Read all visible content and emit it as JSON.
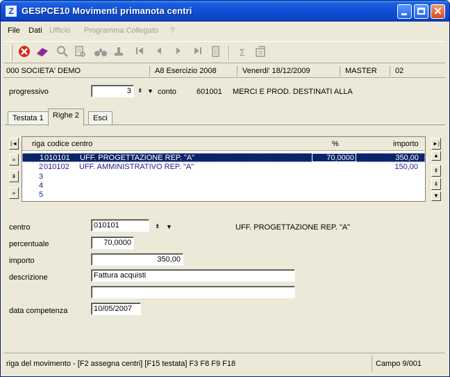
{
  "window": {
    "title": "GESPCE10  Movimenti primanota centri",
    "icon_glyph": "Z"
  },
  "menu": {
    "items": [
      {
        "label": "File",
        "enabled": true
      },
      {
        "label": "Dati",
        "enabled": true
      },
      {
        "label": "Ufficio",
        "enabled": false
      },
      {
        "label": "Programma Collegato",
        "enabled": false
      },
      {
        "label": "?",
        "enabled": false
      }
    ]
  },
  "toolbar": {
    "icons": [
      "cancel-icon",
      "book-icon",
      "search-icon",
      "print-preview-icon",
      "binoculars-icon",
      "stamp-icon",
      "first-record-icon",
      "previous-record-icon",
      "next-record-icon",
      "last-record-icon",
      "export-icon",
      "sigma-icon",
      "calculator-icon"
    ]
  },
  "infobar": {
    "company": "000 SOCIETA' DEMO",
    "exercise": "A8 Esercizio 2008",
    "date": "Venerdi'  18/12/2009",
    "user": "MASTER",
    "terminal": "02"
  },
  "header": {
    "progressivo_label": "progressivo",
    "progressivo_value": "3",
    "conto_label": "conto",
    "conto_code": "601001",
    "conto_desc": "MERCI E PROD. DESTINATI ALLA"
  },
  "tabs": [
    {
      "label": "Testata 1",
      "active": false
    },
    {
      "label": "Righe 2",
      "active": true
    },
    {
      "label": "Esci",
      "active": false
    }
  ],
  "grid": {
    "headers": {
      "riga": "riga",
      "codice": "codice centro",
      "perc": "%",
      "importo": "importo"
    },
    "rows": [
      {
        "riga": "1",
        "codice": "010101",
        "desc": "UFF. PROGETTAZIONE REP. \"A\"",
        "perc": "70,0000",
        "importo": "350,00",
        "selected": true
      },
      {
        "riga": "2",
        "codice": "010102",
        "desc": "UFF. AMMINISTRATIVO REP. \"A\"",
        "perc": "",
        "importo": "150,00",
        "selected": false
      },
      {
        "riga": "3",
        "codice": "",
        "desc": "",
        "perc": "",
        "importo": "",
        "selected": false
      },
      {
        "riga": "4",
        "codice": "",
        "desc": "",
        "perc": "",
        "importo": "",
        "selected": false
      },
      {
        "riga": "5",
        "codice": "",
        "desc": "",
        "perc": "",
        "importo": "",
        "selected": false
      }
    ]
  },
  "detail": {
    "centro_label": "centro",
    "centro_value": "010101",
    "centro_desc": "UFF. PROGETTAZIONE REP. \"A\"",
    "percentuale_label": "percentuale",
    "percentuale_value": "70,0000",
    "importo_label": "importo",
    "importo_value": "350,00",
    "descrizione_label": "descrizione",
    "descrizione_value": "Fattura acquisti",
    "descrizione2_value": "",
    "data_label": "data competenza",
    "data_value": "10/05/2007"
  },
  "status": {
    "left": "riga del movimento  - [F2 assegna centri] [F15 testata] F3 F8 F9 F18",
    "right": "Campo  9/001"
  }
}
